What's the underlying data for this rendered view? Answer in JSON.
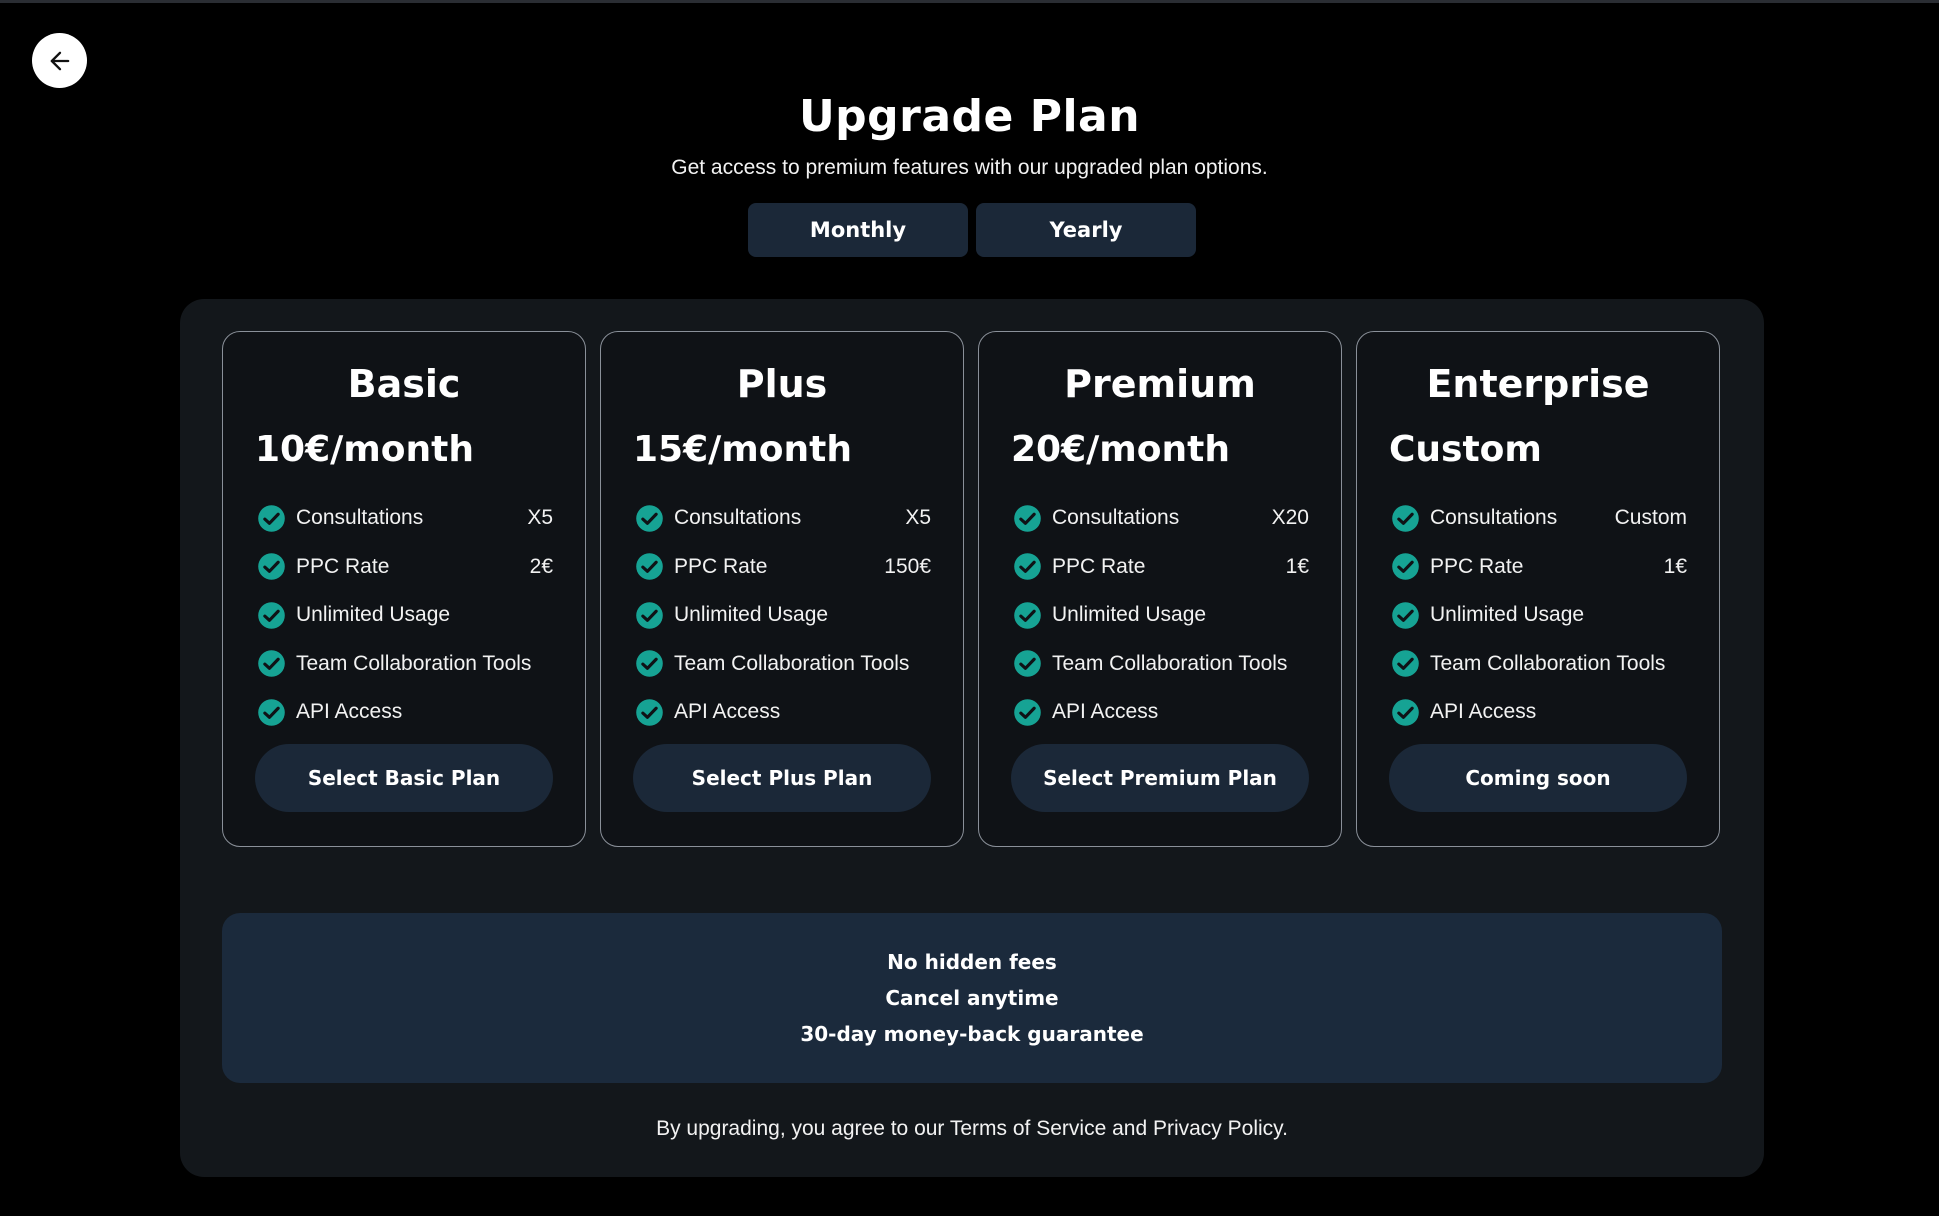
{
  "header": {
    "title": "Upgrade Plan",
    "subtitle": "Get access to premium features with our upgraded plan options."
  },
  "billing_toggle": {
    "monthly": "Monthly",
    "yearly": "Yearly"
  },
  "plans": [
    {
      "name": "Basic",
      "price": "10€/month",
      "features": [
        {
          "label": "Consultations",
          "value": "X5"
        },
        {
          "label": "PPC Rate",
          "value": "2€"
        },
        {
          "label": "Unlimited Usage",
          "value": ""
        },
        {
          "label": "Team Collaboration Tools",
          "value": ""
        },
        {
          "label": "API Access",
          "value": ""
        }
      ],
      "button": "Select Basic Plan"
    },
    {
      "name": "Plus",
      "price": "15€/month",
      "features": [
        {
          "label": "Consultations",
          "value": "X5"
        },
        {
          "label": "PPC Rate",
          "value": "150€"
        },
        {
          "label": "Unlimited Usage",
          "value": ""
        },
        {
          "label": "Team Collaboration Tools",
          "value": ""
        },
        {
          "label": "API Access",
          "value": ""
        }
      ],
      "button": "Select Plus Plan"
    },
    {
      "name": "Premium",
      "price": "20€/month",
      "features": [
        {
          "label": "Consultations",
          "value": "X20"
        },
        {
          "label": "PPC Rate",
          "value": "1€"
        },
        {
          "label": "Unlimited Usage",
          "value": ""
        },
        {
          "label": "Team Collaboration Tools",
          "value": ""
        },
        {
          "label": "API Access",
          "value": ""
        }
      ],
      "button": "Select Premium Plan"
    },
    {
      "name": "Enterprise",
      "price": "Custom",
      "features": [
        {
          "label": "Consultations",
          "value": "Custom"
        },
        {
          "label": "PPC Rate",
          "value": "1€"
        },
        {
          "label": "Unlimited Usage",
          "value": ""
        },
        {
          "label": "Team Collaboration Tools",
          "value": ""
        },
        {
          "label": "API Access",
          "value": ""
        }
      ],
      "button": "Coming soon"
    }
  ],
  "assurance": [
    "No hidden fees",
    "Cancel anytime",
    "30-day money-back guarantee"
  ],
  "footer": {
    "terms": "By upgrading, you agree to our Terms of Service and Privacy Policy."
  },
  "icons": {
    "back": "arrow-left-icon",
    "check": "check-circle-icon"
  },
  "colors": {
    "background": "#000000",
    "panel": "#13171b",
    "card": "#0f1216",
    "button": "#1b2838",
    "assurance_box": "#1b2a3c",
    "check_accent": "#16a394"
  }
}
